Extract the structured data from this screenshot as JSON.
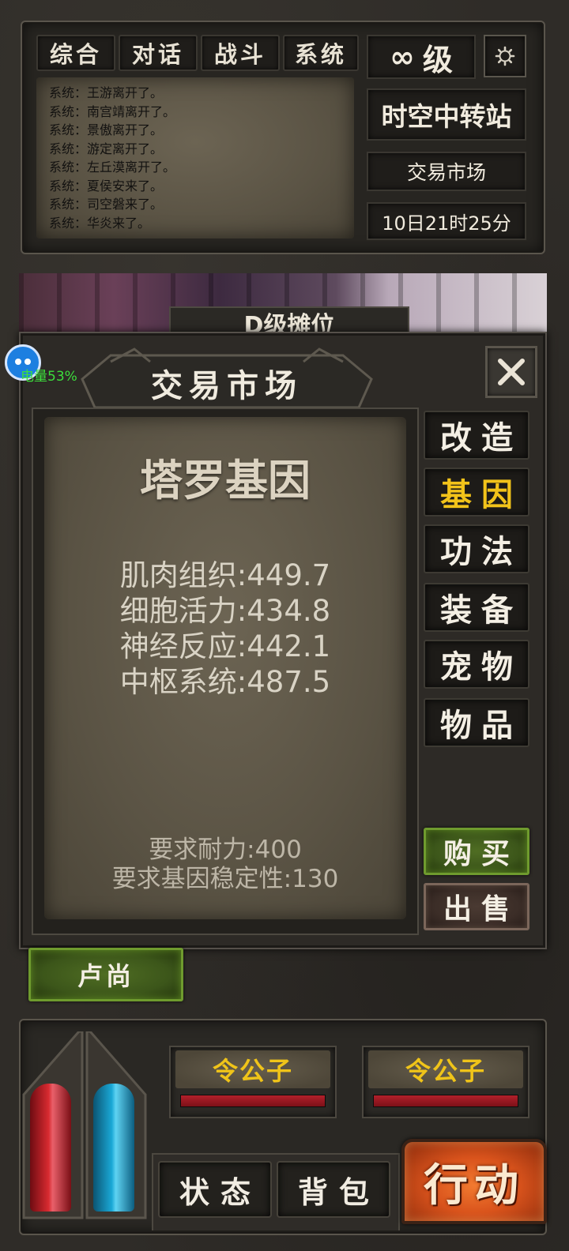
{
  "chat_tabs": [
    "综合",
    "对话",
    "战斗",
    "系统"
  ],
  "level": {
    "symbol": "∞",
    "label": "级"
  },
  "settings_icon": "gear-icon",
  "chat_lines": [
    "系统：王游离开了。",
    "系统：南宫靖离开了。",
    "系统：景傲离开了。",
    "系统：游定离开了。",
    "系统：左丘漠离开了。",
    "系统：夏侯安来了。",
    "系统：司空磐来了。",
    "系统：华炎来了。"
  ],
  "location": {
    "area": "时空中转站",
    "place": "交易市场",
    "time": "10日21时25分"
  },
  "banner_text": "D级摊位",
  "battery_label": "电量53%",
  "battery_percent": 53,
  "market": {
    "title": "交易市场",
    "item_name": "塔罗基因",
    "stats": [
      "肌肉组织:449.7",
      "细胞活力:434.8",
      "神经反应:442.1",
      "中枢系统:487.5"
    ],
    "requirements": [
      "要求耐力:400",
      "要求基因稳定性:130"
    ],
    "categories": [
      "改造",
      "基因",
      "功法",
      "装备",
      "宠物",
      "物品"
    ],
    "active_category": "基因",
    "buy_label": "购买",
    "sell_label": "出售",
    "close_icon": "close-icon"
  },
  "npc_name": "卢尚",
  "party": [
    {
      "name": "令公子",
      "hp": 1.0
    },
    {
      "name": "令公子",
      "hp": 1.0
    }
  ],
  "bottom_actions": {
    "status": "状态",
    "bag": "背包",
    "action": "行动"
  },
  "colors": {
    "active_category": "#f2c31a",
    "name_gold": "#f0c419",
    "hp_red": "#b2202a",
    "mana_blue": "#1aa8d6",
    "action_orange": "#d9531c"
  }
}
